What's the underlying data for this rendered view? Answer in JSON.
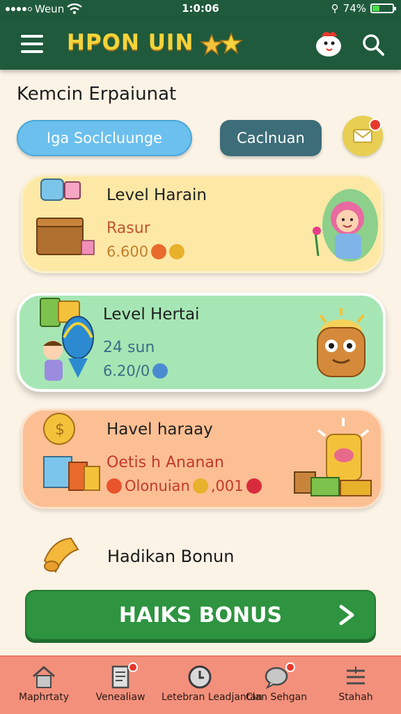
{
  "status_bar": {
    "carrier": "Weun",
    "time": "1:0:06",
    "battery": "74%"
  },
  "header": {
    "title": "HPON UIN",
    "icons": [
      "menu-icon",
      "mascot-icon",
      "search-icon"
    ]
  },
  "section": {
    "title": "Kemcin Erpaiunat"
  },
  "filters": {
    "search_label": "Iga Soclcluunge",
    "action_label": "Caclnuan",
    "mail_icon": "mail-icon"
  },
  "cards": [
    {
      "title": "Level Harain",
      "subtitle": "Rasur",
      "value": "6.600",
      "subtitle_color": "#c2542d",
      "value_color": "#c27f2d"
    },
    {
      "title": "Level Hertai",
      "subtitle": "24 sun",
      "value": "6.20/0",
      "subtitle_color": "#3c6d8a",
      "value_color": "#3c6d8a"
    },
    {
      "title": "Havel haraay",
      "subtitle": "Oetis h Ananan",
      "value_a": "Olonuian",
      "value_b": ",001",
      "subtitle_color": "#c23a2d",
      "value_color": "#c23a2d"
    }
  ],
  "bonus": {
    "label": "Hadikan Bonun",
    "button_label": "HAIKS BONUS"
  },
  "bottom_nav": [
    {
      "label": "Maphrtaty",
      "icon": "home-icon"
    },
    {
      "label": "Venealiaw",
      "icon": "document-icon"
    },
    {
      "label": "Letebran Leadjantan",
      "icon": "clock-icon"
    },
    {
      "label": "Clan Sehgan",
      "icon": "chat-icon"
    },
    {
      "label": "Stahah",
      "icon": "list-icon"
    }
  ],
  "colors": {
    "header_bg": "#1f5a3c",
    "accent_green": "#2e9440",
    "nav_bg": "#f3907c",
    "title_yellow": "#f4d43a"
  }
}
